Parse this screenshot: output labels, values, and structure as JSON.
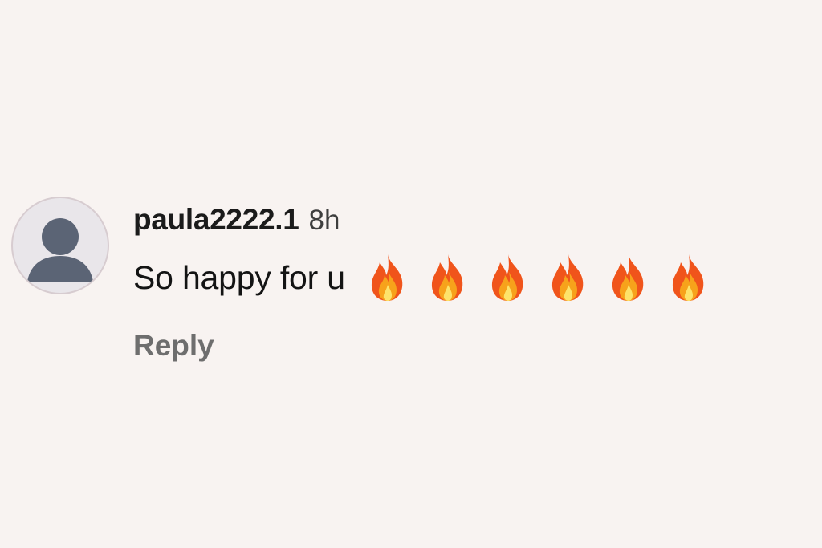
{
  "comment": {
    "avatar_icon": "default-user-avatar-icon",
    "username": "paula2222.1",
    "timestamp": "8h",
    "text": "So happy for u",
    "emojis": [
      "fire-emoji",
      "fire-emoji",
      "fire-emoji",
      "fire-emoji",
      "fire-emoji",
      "fire-emoji"
    ],
    "reply_label": "Reply"
  },
  "colors": {
    "background": "#f8f3f1",
    "username": "#1b1b1b",
    "timestamp": "#3e3e3e",
    "reply": "#6e6e6e",
    "avatar_figure": "#5b6475"
  }
}
